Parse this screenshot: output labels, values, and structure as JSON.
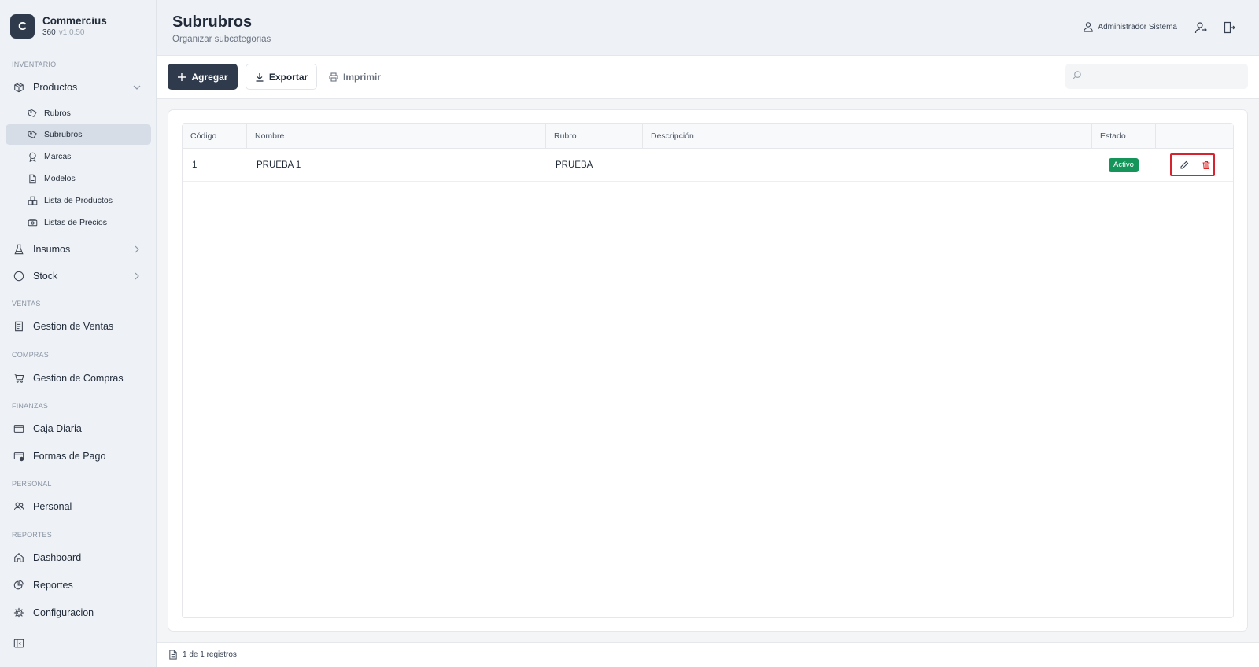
{
  "brand": {
    "logo_letter": "C",
    "name": "Commercius",
    "product": "360",
    "version": "v1.0.50"
  },
  "sidebar": {
    "sections": {
      "inventario": "INVENTARIO",
      "ventas": "VENTAS",
      "compras": "COMPRAS",
      "finanzas": "FINANZAS",
      "personal": "PERSONAL",
      "reportes": "REPORTES"
    },
    "productos": {
      "label": "Productos",
      "subitems": [
        {
          "label": "Rubros",
          "icon": "tag-icon"
        },
        {
          "label": "Subrubros",
          "icon": "tag-icon",
          "active": true
        },
        {
          "label": "Marcas",
          "icon": "award-icon"
        },
        {
          "label": "Modelos",
          "icon": "document-icon"
        },
        {
          "label": "Lista de Productos",
          "icon": "boxes-icon"
        },
        {
          "label": "Listas de Precios",
          "icon": "money-icon"
        }
      ]
    },
    "insumos": "Insumos",
    "stock": "Stock",
    "gestion_ventas": "Gestion de Ventas",
    "gestion_compras": "Gestion de Compras",
    "caja_diaria": "Caja Diaria",
    "formas_pago": "Formas de Pago",
    "personal": "Personal",
    "dashboard": "Dashboard",
    "reportes": "Reportes",
    "configuracion": "Configuracion"
  },
  "header": {
    "title": "Subrubros",
    "subtitle": "Organizar subcategorias",
    "user_name": "Administrador Sistema"
  },
  "toolbar": {
    "add_label": "Agregar",
    "export_label": "Exportar",
    "print_label": "Imprimir",
    "search_placeholder": ""
  },
  "table": {
    "columns": [
      "Código",
      "Nombre",
      "Rubro",
      "Descripción",
      "Estado",
      ""
    ],
    "rows": [
      {
        "codigo": "1",
        "nombre": "PRUEBA 1",
        "rubro": "PRUEBA",
        "descripcion": "",
        "estado": "Activo"
      }
    ]
  },
  "footer": {
    "records_text": "1 de 1 registros"
  },
  "colors": {
    "primary": "#2f3b4c",
    "sidebar_bg": "#eef2f6",
    "active_badge": "#16955b",
    "delete_icon": "#dc2626",
    "highlight_box": "#d5232f"
  }
}
